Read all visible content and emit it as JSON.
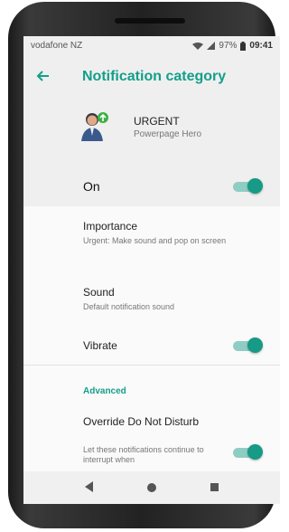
{
  "status_bar": {
    "carrier": "vodafone NZ",
    "battery": "97%",
    "time": "09:41"
  },
  "app_bar": {
    "title": "Notification category"
  },
  "category": {
    "name": "URGENT",
    "app": "Powerpage Hero",
    "on_label": "On",
    "on_state": true
  },
  "settings": {
    "importance": {
      "title": "Importance",
      "value": "Urgent: Make sound and pop on screen"
    },
    "sound": {
      "title": "Sound",
      "value": "Default notification sound"
    },
    "vibrate": {
      "title": "Vibrate",
      "state": true
    }
  },
  "advanced": {
    "header": "Advanced",
    "override": {
      "title": "Override Do Not Disturb",
      "desc": "Let these notifications continue to interrupt when",
      "state": true
    }
  },
  "colors": {
    "accent": "#159e8a",
    "toggle_thumb": "#179a86",
    "toggle_track": "#8fcdc4"
  },
  "icons": [
    "back-arrow-icon",
    "wifi-icon",
    "signal-icon",
    "battery-icon",
    "nav-back-icon",
    "nav-home-icon",
    "nav-recent-icon"
  ]
}
